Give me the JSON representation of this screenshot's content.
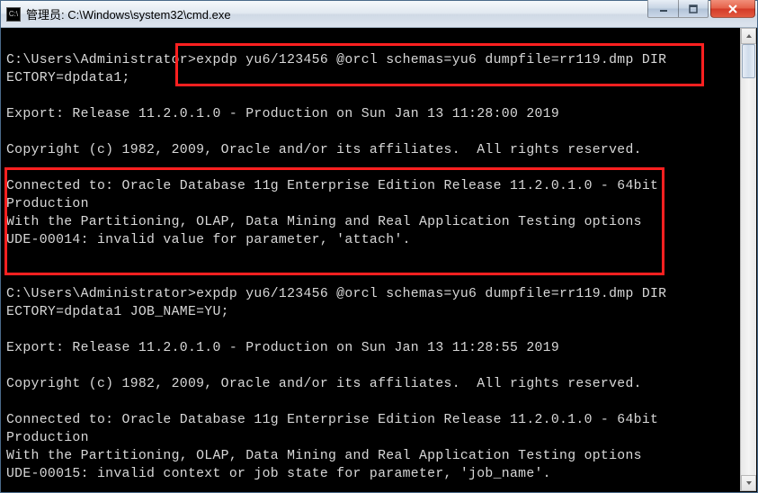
{
  "window": {
    "title": "管理员: C:\\Windows\\system32\\cmd.exe",
    "icon_label": "C:\\"
  },
  "terminal": {
    "lines": [
      "",
      "C:\\Users\\Administrator>expdp yu6/123456 @orcl schemas=yu6 dumpfile=rr119.dmp DIR",
      "ECTORY=dpdata1;",
      "",
      "Export: Release 11.2.0.1.0 - Production on Sun Jan 13 11:28:00 2019",
      "",
      "Copyright (c) 1982, 2009, Oracle and/or its affiliates.  All rights reserved.",
      "",
      "Connected to: Oracle Database 11g Enterprise Edition Release 11.2.0.1.0 - 64bit",
      "Production",
      "With the Partitioning, OLAP, Data Mining and Real Application Testing options",
      "UDE-00014: invalid value for parameter, 'attach'.",
      "",
      "",
      "C:\\Users\\Administrator>expdp yu6/123456 @orcl schemas=yu6 dumpfile=rr119.dmp DIR",
      "ECTORY=dpdata1 JOB_NAME=YU;",
      "",
      "Export: Release 11.2.0.1.0 - Production on Sun Jan 13 11:28:55 2019",
      "",
      "Copyright (c) 1982, 2009, Oracle and/or its affiliates.  All rights reserved.",
      "",
      "Connected to: Oracle Database 11g Enterprise Edition Release 11.2.0.1.0 - 64bit",
      "Production",
      "With the Partitioning, OLAP, Data Mining and Real Application Testing options",
      "UDE-00015: invalid context or job state for parameter, 'job_name'."
    ]
  }
}
